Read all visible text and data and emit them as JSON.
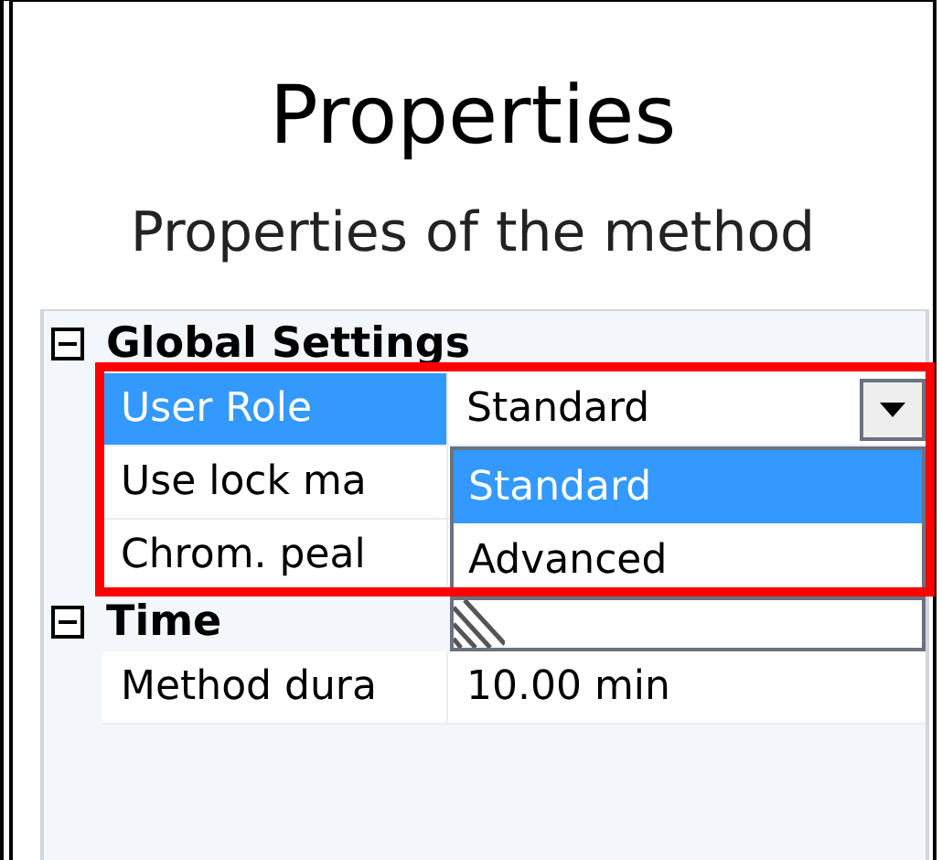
{
  "title": "Properties",
  "subtitle": "Properties of the method",
  "groups": [
    {
      "label": "Global Settings",
      "expanded": true,
      "rows": [
        {
          "label": "User Role",
          "value": "Standard",
          "kind": "dropdown",
          "selected": true
        },
        {
          "label": "Use lock ma",
          "kind": "hidden",
          "selected": false
        },
        {
          "label": "Chrom. peal",
          "kind": "hidden",
          "selected": false
        }
      ]
    },
    {
      "label": "Time",
      "expanded": true,
      "rows": [
        {
          "label": "Method dura",
          "value": "10.00 min",
          "kind": "text",
          "selected": false
        }
      ]
    }
  ],
  "dropdown_list": {
    "options": [
      {
        "label": "Standard",
        "selected": true
      },
      {
        "label": "Advanced",
        "selected": false
      }
    ]
  }
}
